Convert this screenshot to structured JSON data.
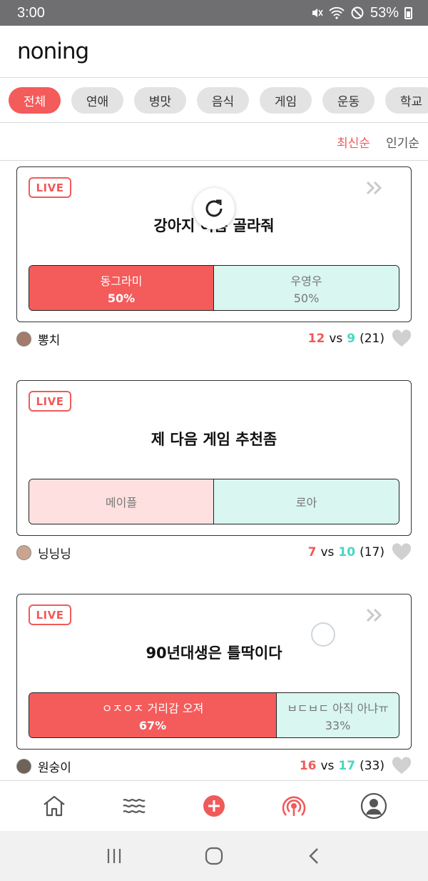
{
  "status_bar": {
    "time": "3:00",
    "battery_percent": "53%",
    "icons": [
      "mute-icon",
      "wifi-icon",
      "no-disturb-icon",
      "battery-icon"
    ]
  },
  "app": {
    "logo": "noning"
  },
  "categories": [
    "전체",
    "연애",
    "병맛",
    "음식",
    "게임",
    "운동",
    "학교"
  ],
  "active_category": "전체",
  "sort": {
    "latest": "최신순",
    "popular": "인기순",
    "active": "최신순"
  },
  "posts": [
    {
      "badge": "LIVE",
      "title": "강아지 이름 골라줘",
      "option_a": {
        "label": "동그라미",
        "percent": "50%"
      },
      "option_b": {
        "label": "우영우",
        "percent": "50%"
      },
      "author": "뽕치",
      "score_a": "12",
      "vs": "vs",
      "score_b": "9",
      "total": "(21)"
    },
    {
      "badge": "LIVE",
      "title": "제 다음 게임 추천좀",
      "option_a": {
        "label": "메이플",
        "percent": ""
      },
      "option_b": {
        "label": "로아",
        "percent": ""
      },
      "author": "닝닝닝",
      "score_a": "7",
      "vs": "vs",
      "score_b": "10",
      "total": "(17)"
    },
    {
      "badge": "LIVE",
      "title": "90년대생은 틀딱이다",
      "option_a": {
        "label": "ㅇㅈㅇㅈ 거리감 오져",
        "percent": "67%"
      },
      "option_b": {
        "label": "ㅂㄷㅂㄷ 아직 아냐ㅠ",
        "percent": "33%"
      },
      "author": "원숭이",
      "score_a": "16",
      "vs": "vs",
      "score_b": "17",
      "total": "(33)"
    }
  ],
  "bottom_nav": [
    "home-icon",
    "feed-waves-icon",
    "add-post-icon",
    "live-broadcast-icon",
    "profile-icon"
  ],
  "colors": {
    "accent": "#f15a5a",
    "teal": "#48d6c3",
    "option_b_bg": "#d9f6f1"
  }
}
